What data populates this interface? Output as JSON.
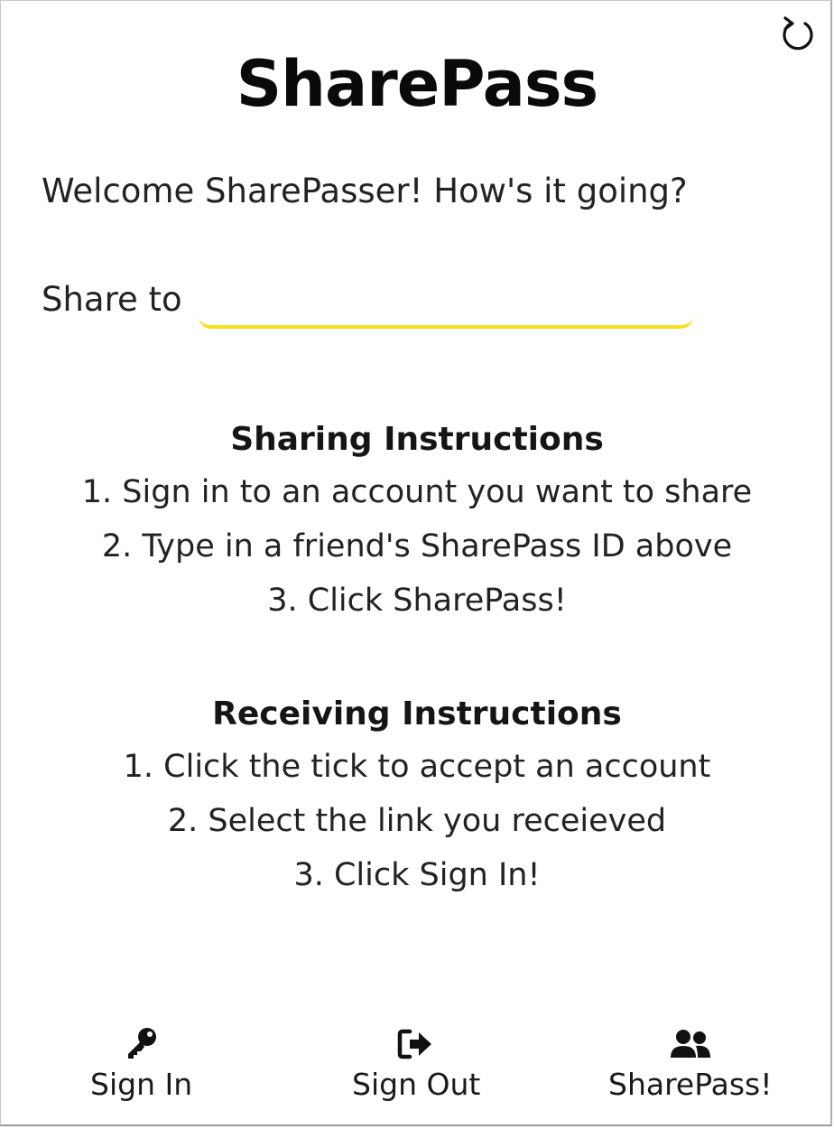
{
  "app": {
    "title": "SharePass",
    "welcome": "Welcome SharePasser! How's it going?"
  },
  "share": {
    "label": "Share to",
    "value": "",
    "placeholder": "",
    "accent_color": "#f7df1e"
  },
  "sharing": {
    "heading": "Sharing Instructions",
    "steps": [
      "1. Sign in to an account you want to share",
      "2. Type in a friend's SharePass ID above",
      "3. Click SharePass!"
    ]
  },
  "receiving": {
    "heading": "Receiving Instructions",
    "steps": [
      "1. Click the tick to accept an account",
      "2. Select the link you receieved",
      "3. Click Sign In!"
    ]
  },
  "nav": {
    "sign_in": {
      "label": "Sign In",
      "icon": "key-icon"
    },
    "sign_out": {
      "label": "Sign Out",
      "icon": "sign-out-icon"
    },
    "sharepass": {
      "label": "SharePass!",
      "icon": "users-icon"
    }
  },
  "toolbar": {
    "refresh_icon": "refresh-icon"
  }
}
